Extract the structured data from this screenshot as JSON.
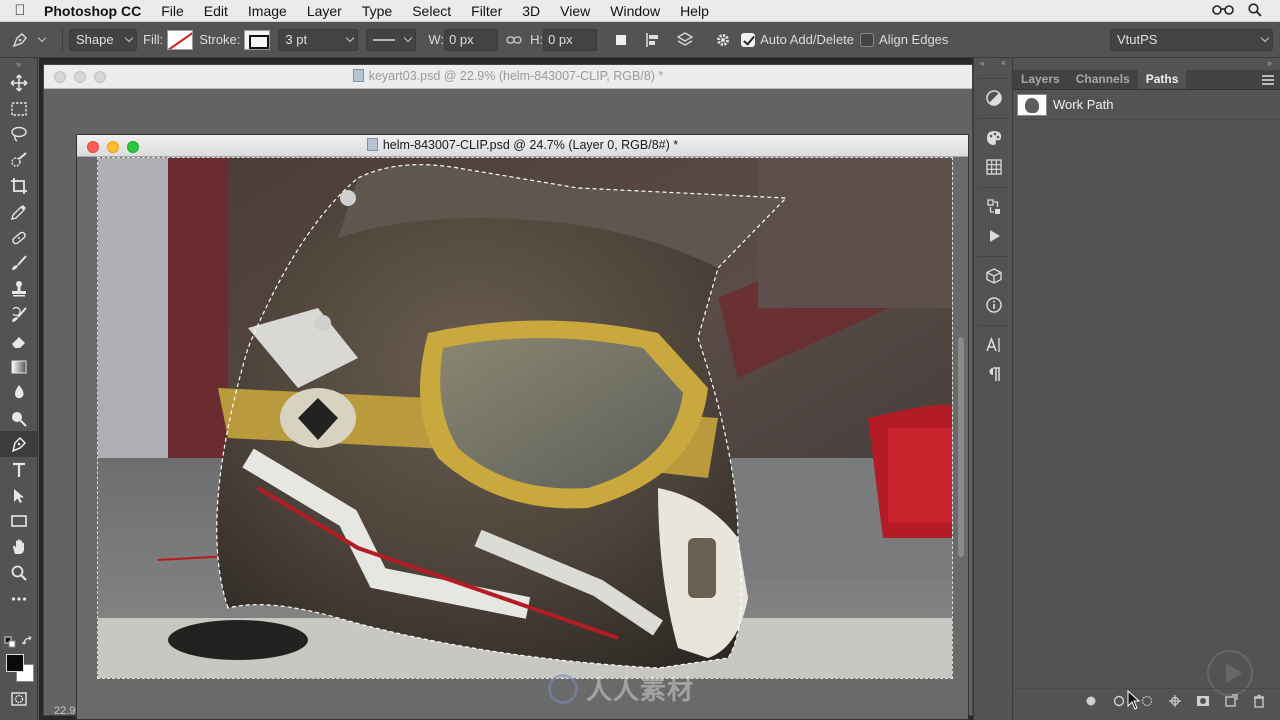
{
  "menubar": {
    "app_name": "Photoshop CC",
    "items": [
      "File",
      "Edit",
      "Image",
      "Layer",
      "Type",
      "Select",
      "Filter",
      "3D",
      "View",
      "Window",
      "Help"
    ]
  },
  "options_bar": {
    "mode": "Shape",
    "fill_label": "Fill:",
    "stroke_label": "Stroke:",
    "stroke_width": "3 pt",
    "w_label": "W:",
    "w_value": "0 px",
    "h_label": "H:",
    "h_value": "0 px",
    "auto_add_delete_label": "Auto Add/Delete",
    "auto_add_delete_checked": true,
    "align_edges_label": "Align Edges",
    "align_edges_checked": false,
    "workspace": "VtutPS"
  },
  "documents": {
    "back": {
      "title": "keyart03.psd @ 22.9% (helm-843007-CLIP, RGB/8) *",
      "zoom": "22.9"
    },
    "front": {
      "title": "helm-843007-CLIP.psd @ 24.7% (Layer 0, RGB/8#) *"
    }
  },
  "paths_panel": {
    "tabs": [
      "Layers",
      "Channels",
      "Paths"
    ],
    "active_tab": "Paths",
    "paths": [
      {
        "name": "Work Path"
      }
    ]
  },
  "watermark": "人人素材",
  "colors": {
    "accent_red": "#d41e1e",
    "ui_dark": "#535353",
    "foreground": "#0a0a0a",
    "background": "#ffffff"
  },
  "tools": [
    "move-tool",
    "marquee-tool",
    "lasso-tool",
    "quick-select-tool",
    "crop-tool",
    "eyedropper-tool",
    "healing-brush-tool",
    "brush-tool",
    "clone-stamp-tool",
    "history-brush-tool",
    "eraser-tool",
    "gradient-tool",
    "blur-tool",
    "dodge-tool",
    "pen-tool",
    "type-tool",
    "path-selection-tool",
    "rectangle-tool",
    "hand-tool",
    "zoom-tool",
    "more-tools"
  ],
  "active_tool": "pen-tool"
}
